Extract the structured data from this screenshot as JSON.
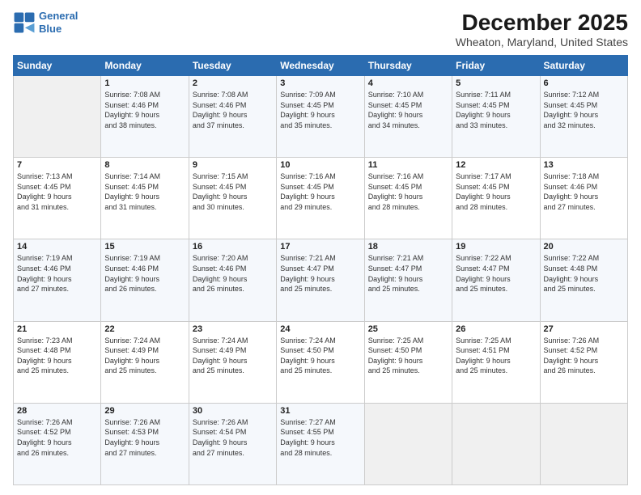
{
  "logo": {
    "line1": "General",
    "line2": "Blue"
  },
  "title": "December 2025",
  "subtitle": "Wheaton, Maryland, United States",
  "days_header": [
    "Sunday",
    "Monday",
    "Tuesday",
    "Wednesday",
    "Thursday",
    "Friday",
    "Saturday"
  ],
  "weeks": [
    [
      {
        "num": "",
        "info": ""
      },
      {
        "num": "1",
        "info": "Sunrise: 7:08 AM\nSunset: 4:46 PM\nDaylight: 9 hours\nand 38 minutes."
      },
      {
        "num": "2",
        "info": "Sunrise: 7:08 AM\nSunset: 4:46 PM\nDaylight: 9 hours\nand 37 minutes."
      },
      {
        "num": "3",
        "info": "Sunrise: 7:09 AM\nSunset: 4:45 PM\nDaylight: 9 hours\nand 35 minutes."
      },
      {
        "num": "4",
        "info": "Sunrise: 7:10 AM\nSunset: 4:45 PM\nDaylight: 9 hours\nand 34 minutes."
      },
      {
        "num": "5",
        "info": "Sunrise: 7:11 AM\nSunset: 4:45 PM\nDaylight: 9 hours\nand 33 minutes."
      },
      {
        "num": "6",
        "info": "Sunrise: 7:12 AM\nSunset: 4:45 PM\nDaylight: 9 hours\nand 32 minutes."
      }
    ],
    [
      {
        "num": "7",
        "info": "Sunrise: 7:13 AM\nSunset: 4:45 PM\nDaylight: 9 hours\nand 31 minutes."
      },
      {
        "num": "8",
        "info": "Sunrise: 7:14 AM\nSunset: 4:45 PM\nDaylight: 9 hours\nand 31 minutes."
      },
      {
        "num": "9",
        "info": "Sunrise: 7:15 AM\nSunset: 4:45 PM\nDaylight: 9 hours\nand 30 minutes."
      },
      {
        "num": "10",
        "info": "Sunrise: 7:16 AM\nSunset: 4:45 PM\nDaylight: 9 hours\nand 29 minutes."
      },
      {
        "num": "11",
        "info": "Sunrise: 7:16 AM\nSunset: 4:45 PM\nDaylight: 9 hours\nand 28 minutes."
      },
      {
        "num": "12",
        "info": "Sunrise: 7:17 AM\nSunset: 4:45 PM\nDaylight: 9 hours\nand 28 minutes."
      },
      {
        "num": "13",
        "info": "Sunrise: 7:18 AM\nSunset: 4:46 PM\nDaylight: 9 hours\nand 27 minutes."
      }
    ],
    [
      {
        "num": "14",
        "info": "Sunrise: 7:19 AM\nSunset: 4:46 PM\nDaylight: 9 hours\nand 27 minutes."
      },
      {
        "num": "15",
        "info": "Sunrise: 7:19 AM\nSunset: 4:46 PM\nDaylight: 9 hours\nand 26 minutes."
      },
      {
        "num": "16",
        "info": "Sunrise: 7:20 AM\nSunset: 4:46 PM\nDaylight: 9 hours\nand 26 minutes."
      },
      {
        "num": "17",
        "info": "Sunrise: 7:21 AM\nSunset: 4:47 PM\nDaylight: 9 hours\nand 25 minutes."
      },
      {
        "num": "18",
        "info": "Sunrise: 7:21 AM\nSunset: 4:47 PM\nDaylight: 9 hours\nand 25 minutes."
      },
      {
        "num": "19",
        "info": "Sunrise: 7:22 AM\nSunset: 4:47 PM\nDaylight: 9 hours\nand 25 minutes."
      },
      {
        "num": "20",
        "info": "Sunrise: 7:22 AM\nSunset: 4:48 PM\nDaylight: 9 hours\nand 25 minutes."
      }
    ],
    [
      {
        "num": "21",
        "info": "Sunrise: 7:23 AM\nSunset: 4:48 PM\nDaylight: 9 hours\nand 25 minutes."
      },
      {
        "num": "22",
        "info": "Sunrise: 7:24 AM\nSunset: 4:49 PM\nDaylight: 9 hours\nand 25 minutes."
      },
      {
        "num": "23",
        "info": "Sunrise: 7:24 AM\nSunset: 4:49 PM\nDaylight: 9 hours\nand 25 minutes."
      },
      {
        "num": "24",
        "info": "Sunrise: 7:24 AM\nSunset: 4:50 PM\nDaylight: 9 hours\nand 25 minutes."
      },
      {
        "num": "25",
        "info": "Sunrise: 7:25 AM\nSunset: 4:50 PM\nDaylight: 9 hours\nand 25 minutes."
      },
      {
        "num": "26",
        "info": "Sunrise: 7:25 AM\nSunset: 4:51 PM\nDaylight: 9 hours\nand 25 minutes."
      },
      {
        "num": "27",
        "info": "Sunrise: 7:26 AM\nSunset: 4:52 PM\nDaylight: 9 hours\nand 26 minutes."
      }
    ],
    [
      {
        "num": "28",
        "info": "Sunrise: 7:26 AM\nSunset: 4:52 PM\nDaylight: 9 hours\nand 26 minutes."
      },
      {
        "num": "29",
        "info": "Sunrise: 7:26 AM\nSunset: 4:53 PM\nDaylight: 9 hours\nand 27 minutes."
      },
      {
        "num": "30",
        "info": "Sunrise: 7:26 AM\nSunset: 4:54 PM\nDaylight: 9 hours\nand 27 minutes."
      },
      {
        "num": "31",
        "info": "Sunrise: 7:27 AM\nSunset: 4:55 PM\nDaylight: 9 hours\nand 28 minutes."
      },
      {
        "num": "",
        "info": ""
      },
      {
        "num": "",
        "info": ""
      },
      {
        "num": "",
        "info": ""
      }
    ]
  ]
}
